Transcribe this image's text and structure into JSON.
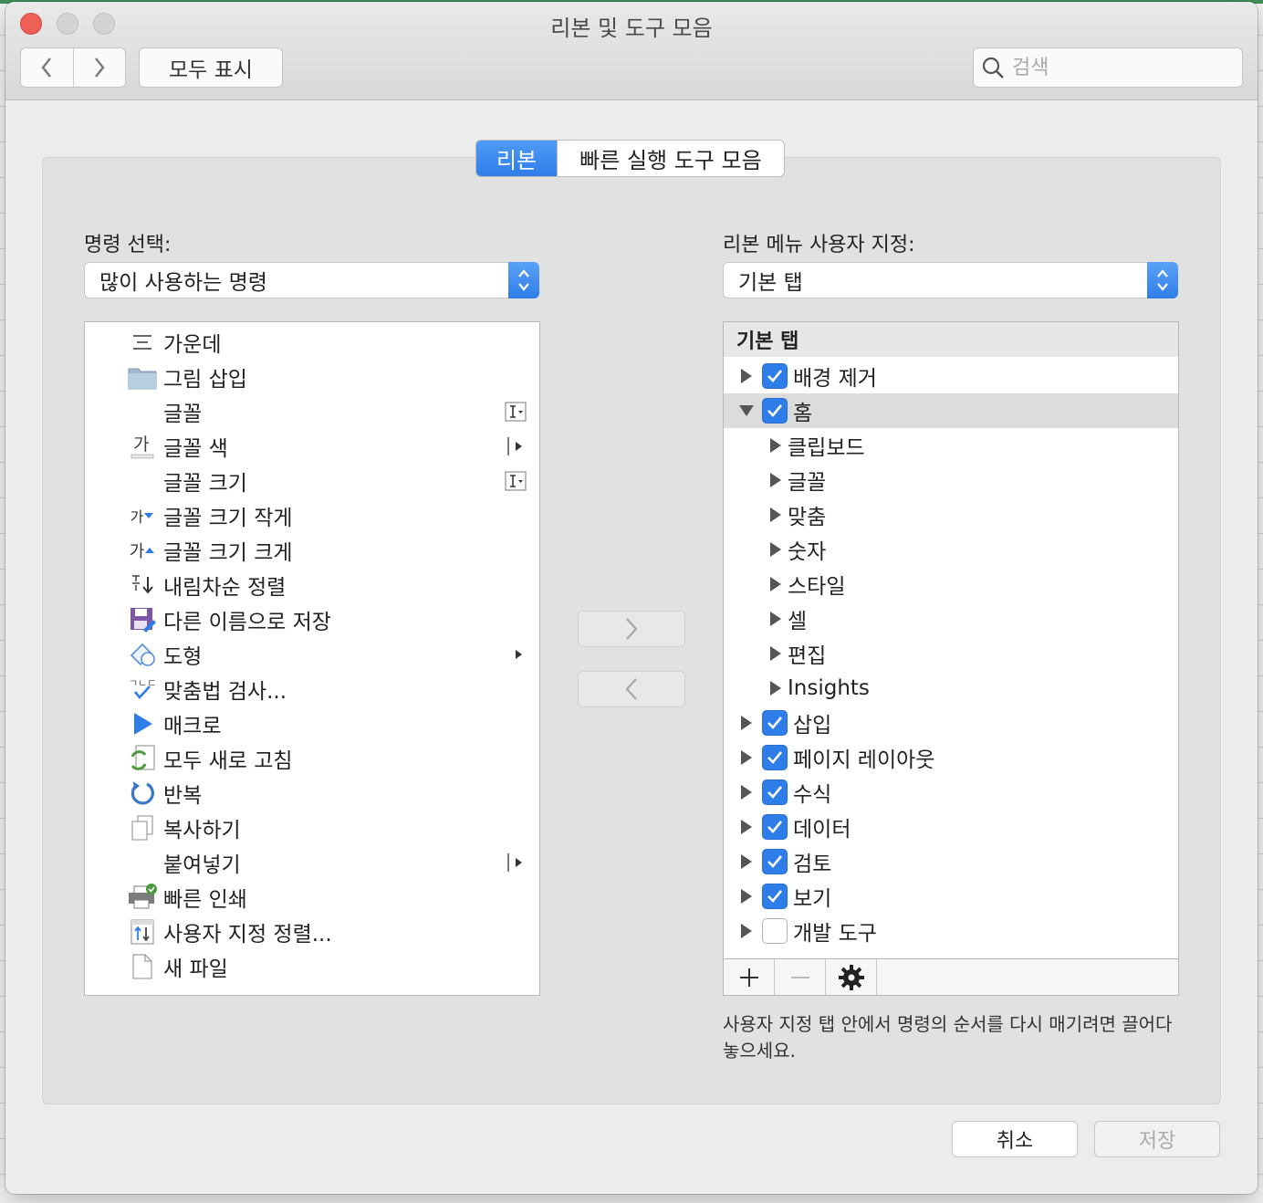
{
  "window": {
    "title": "리본 및 도구 모음"
  },
  "toolbar": {
    "show_all": "모두 표시",
    "search_placeholder": "검색"
  },
  "tabs": [
    {
      "label": "리본",
      "active": true
    },
    {
      "label": "빠른 실행 도구 모음",
      "active": false
    }
  ],
  "left": {
    "label": "명령 선택:",
    "select_value": "많이 사용하는 명령",
    "items": [
      {
        "label": "가운데",
        "icon": "align-center-icon"
      },
      {
        "label": "그림 삽입",
        "icon": "folder-icon"
      },
      {
        "label": "글꼴",
        "icon": "",
        "accessory": "text-cursor"
      },
      {
        "label": "글꼴 색",
        "icon": "font-color-icon",
        "accessory": "submenu"
      },
      {
        "label": "글꼴 크기",
        "icon": "",
        "accessory": "text-cursor"
      },
      {
        "label": "글꼴 크기 작게",
        "icon": "font-decrease-icon",
        "icon_text": "가"
      },
      {
        "label": "글꼴 크기 크게",
        "icon": "font-increase-icon",
        "icon_text": "가"
      },
      {
        "label": "내림차순 정렬",
        "icon": "sort-descending-icon"
      },
      {
        "label": "다른 이름으로 저장",
        "icon": "save-as-icon"
      },
      {
        "label": "도형",
        "icon": "shapes-icon",
        "accessory": "arrow"
      },
      {
        "label": "맞춤법 검사...",
        "icon": "spelling-icon"
      },
      {
        "label": "매크로",
        "icon": "play-icon"
      },
      {
        "label": "모두 새로 고침",
        "icon": "refresh-all-icon"
      },
      {
        "label": "반복",
        "icon": "redo-icon"
      },
      {
        "label": "복사하기",
        "icon": "copy-icon"
      },
      {
        "label": "붙여넣기",
        "icon": "",
        "accessory": "submenu"
      },
      {
        "label": "빠른 인쇄",
        "icon": "printer-icon"
      },
      {
        "label": "사용자 지정 정렬...",
        "icon": "custom-sort-icon"
      },
      {
        "label": "새 파일",
        "icon": "new-file-icon"
      }
    ]
  },
  "right": {
    "label": "리본 메뉴 사용자 지정:",
    "select_value": "기본 탭",
    "tree_header": "기본 탭",
    "tree": [
      {
        "label": "배경 제거",
        "level": 0,
        "expanded": false,
        "checked": true
      },
      {
        "label": "홈",
        "level": 0,
        "expanded": true,
        "checked": true,
        "selected": true
      },
      {
        "label": "클립보드",
        "level": 1
      },
      {
        "label": "글꼴",
        "level": 1
      },
      {
        "label": "맞춤",
        "level": 1
      },
      {
        "label": "숫자",
        "level": 1
      },
      {
        "label": "스타일",
        "level": 1
      },
      {
        "label": "셀",
        "level": 1
      },
      {
        "label": "편집",
        "level": 1
      },
      {
        "label": "Insights",
        "level": 1
      },
      {
        "label": "삽입",
        "level": 0,
        "expanded": false,
        "checked": true
      },
      {
        "label": "페이지 레이아웃",
        "level": 0,
        "expanded": false,
        "checked": true
      },
      {
        "label": "수식",
        "level": 0,
        "expanded": false,
        "checked": true
      },
      {
        "label": "데이터",
        "level": 0,
        "expanded": false,
        "checked": true
      },
      {
        "label": "검토",
        "level": 0,
        "expanded": false,
        "checked": true
      },
      {
        "label": "보기",
        "level": 0,
        "expanded": false,
        "checked": true
      },
      {
        "label": "개발 도구",
        "level": 0,
        "expanded": false,
        "checked": false
      }
    ],
    "hint": "사용자 지정 탭 안에서 명령의 순서를 다시 매기려면 끌어다 놓으세요."
  },
  "footer": {
    "cancel": "취소",
    "save": "저장"
  },
  "colors": {
    "accent": "#2f7de8",
    "close": "#ee5f58"
  }
}
